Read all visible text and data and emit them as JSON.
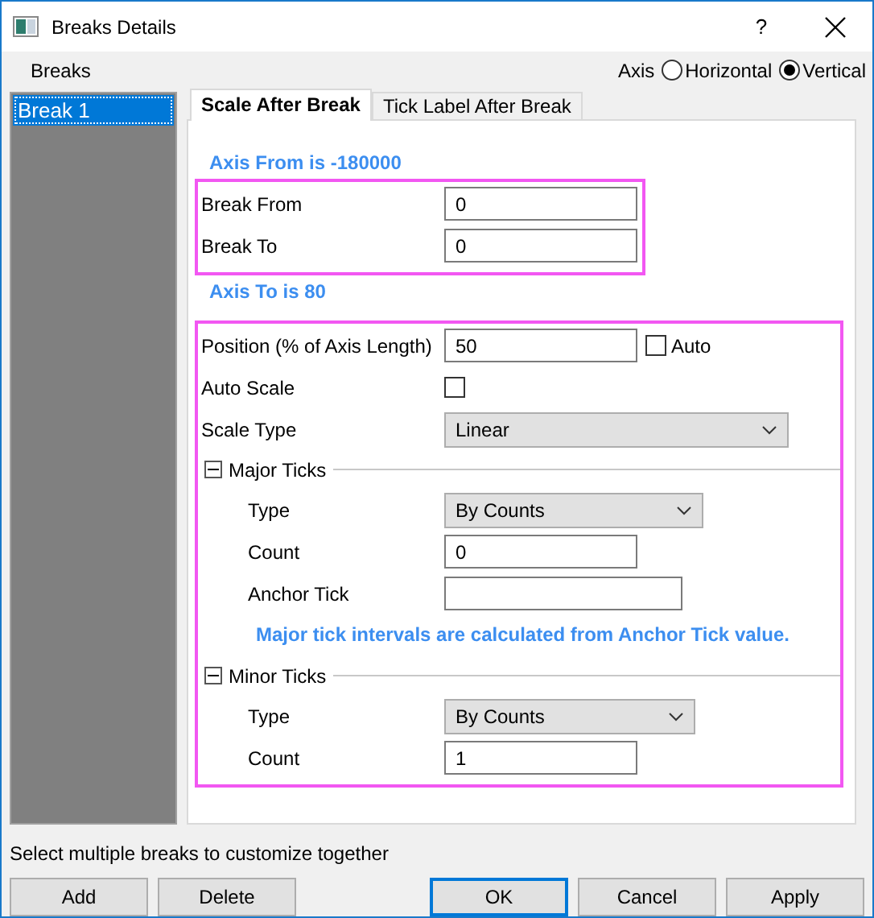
{
  "window": {
    "title": "Breaks Details",
    "help": "?"
  },
  "breaks_label": "Breaks",
  "axis": {
    "label": "Axis",
    "options": [
      {
        "label": "Horizontal",
        "selected": false
      },
      {
        "label": "Vertical",
        "selected": true
      }
    ]
  },
  "breaks_list": [
    {
      "label": "Break 1",
      "selected": true
    }
  ],
  "tabs": [
    {
      "label": "Scale After Break",
      "selected": true
    },
    {
      "label": "Tick Label After Break",
      "selected": false
    }
  ],
  "axis_from": "Axis From is -180000",
  "break_range": [
    {
      "label": "Break From",
      "value": "0"
    },
    {
      "label": "Break To",
      "value": "0"
    }
  ],
  "axis_to": "Axis To is 80",
  "scale_rows": [
    {
      "kind": "input",
      "label": "Position (% of Axis Length)",
      "value": "50",
      "option": {
        "label": "Auto",
        "checked": false
      }
    },
    {
      "kind": "checkbox",
      "label": "Auto Scale",
      "checked": false
    },
    {
      "kind": "dropdown",
      "label": "Scale Type",
      "value": "Linear"
    }
  ],
  "groups": [
    {
      "title": "Major Ticks",
      "expanded": true,
      "rows": [
        {
          "kind": "dropdown",
          "label": "Type",
          "value": "By Counts"
        },
        {
          "kind": "input",
          "label": "Count",
          "value": "0"
        },
        {
          "kind": "input",
          "label": "Anchor Tick",
          "value": ""
        }
      ],
      "note": "Major tick intervals are calculated from Anchor Tick value."
    },
    {
      "title": "Minor Ticks",
      "expanded": true,
      "rows": [
        {
          "kind": "dropdown",
          "label": "Type",
          "value": "By Counts"
        },
        {
          "kind": "input",
          "label": "Count",
          "value": "1"
        }
      ]
    }
  ],
  "hint": "Select multiple breaks to customize together",
  "buttons": [
    {
      "label": "Add",
      "default": false
    },
    {
      "label": "Delete",
      "default": false
    },
    {
      "label": "OK",
      "default": true
    },
    {
      "label": "Cancel",
      "default": false
    },
    {
      "label": "Apply",
      "default": false
    }
  ]
}
